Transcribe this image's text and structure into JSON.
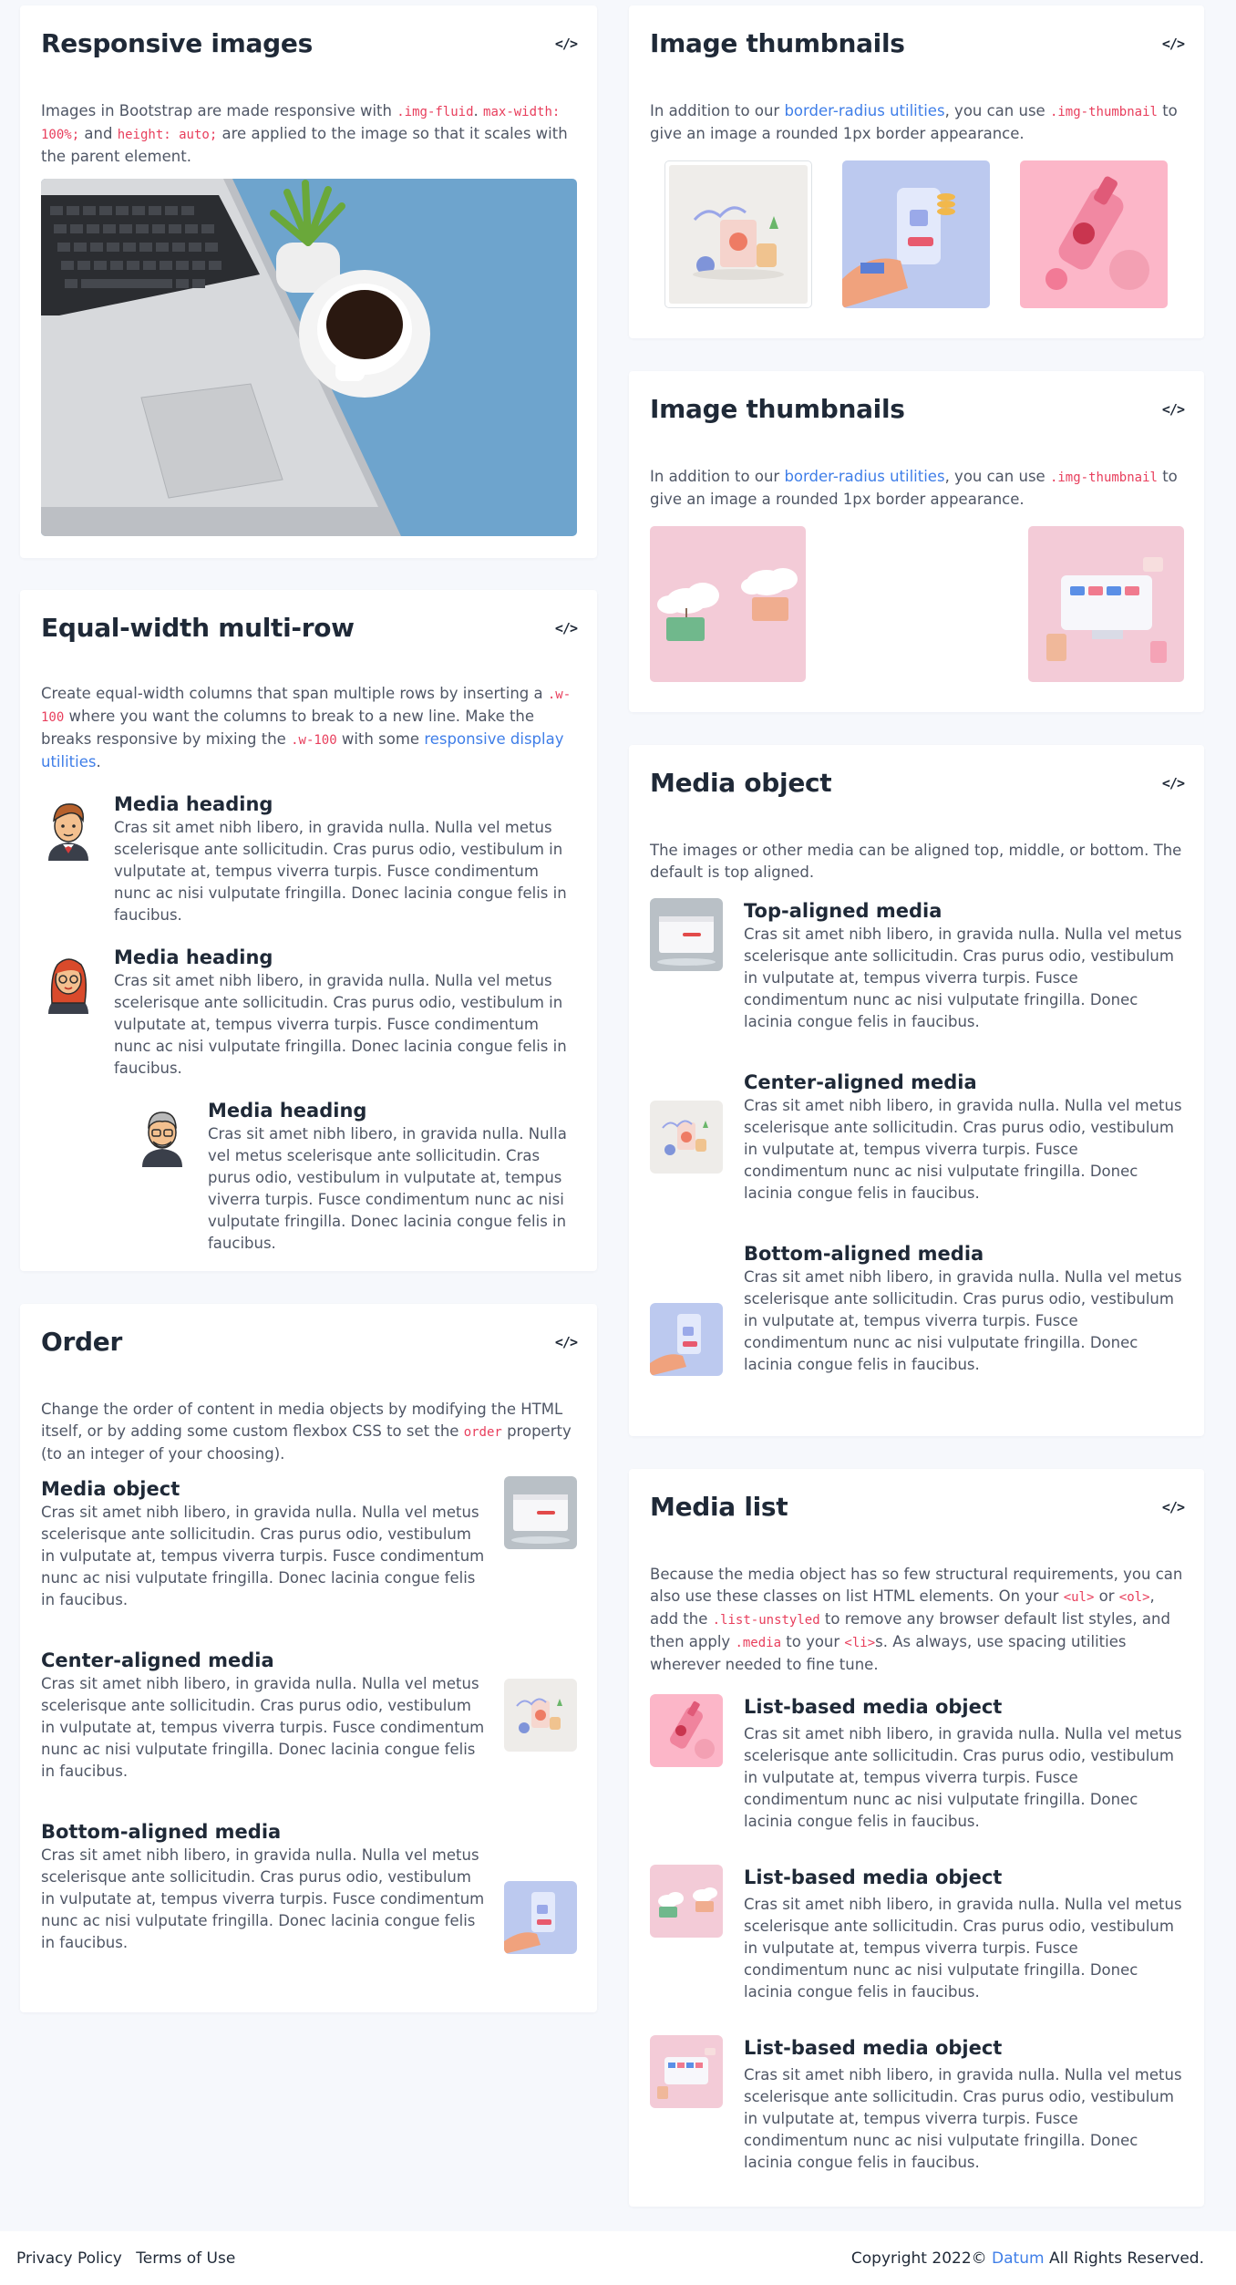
{
  "responsive": {
    "title": "Responsive images",
    "desc_a": "Images in Bootstrap are made responsive with ",
    "code_a": ".img-fluid",
    "desc_b": ". ",
    "code_b": "max-width: 100%;",
    "desc_c": " and ",
    "code_c": "height: auto;",
    "desc_d": " are applied to the image so that it scales with the parent element."
  },
  "thumbs1": {
    "title": "Image thumbnails",
    "desc_a": "In addition to our ",
    "link": "border-radius utilities",
    "desc_b": ", you can use ",
    "code": ".img-thumbnail",
    "desc_c": " to give an image a rounded 1px border appearance."
  },
  "thumbs2": {
    "title": "Image thumbnails",
    "desc_a": "In addition to our ",
    "link": "border-radius utilities",
    "desc_b": ", you can use ",
    "code": ".img-thumbnail",
    "desc_c": " to give an image a rounded 1px border appearance."
  },
  "equal": {
    "title": "Equal-width multi-row",
    "desc_a": "Create equal-width columns that span multiple rows by inserting a ",
    "code_a": ".w-100",
    "desc_b": " where you want the columns to break to a new line. Make the breaks responsive by mixing the ",
    "code_b": ".w-100",
    "desc_c": " with some ",
    "link": "responsive display utilities",
    "desc_d": ".",
    "items": [
      {
        "heading": "Media heading",
        "text": "Cras sit amet nibh libero, in gravida nulla. Nulla vel metus scelerisque ante sollicitudin. Cras purus odio, vestibulum in vulputate at, tempus viverra turpis. Fusce condimentum nunc ac nisi vulputate fringilla. Donec lacinia congue felis in faucibus."
      },
      {
        "heading": "Media heading",
        "text": "Cras sit amet nibh libero, in gravida nulla. Nulla vel metus scelerisque ante sollicitudin. Cras purus odio, vestibulum in vulputate at, tempus viverra turpis. Fusce condimentum nunc ac nisi vulputate fringilla. Donec lacinia congue felis in faucibus."
      },
      {
        "heading": "Media heading",
        "text": "Cras sit amet nibh libero, in gravida nulla. Nulla vel metus scelerisque ante sollicitudin. Cras purus odio, vestibulum in vulputate at, tempus viverra turpis. Fusce condimentum nunc ac nisi vulputate fringilla. Donec lacinia congue felis in faucibus."
      }
    ]
  },
  "mediaobj": {
    "title": "Media object",
    "desc": "The images or other media can be aligned top, middle, or bottom. The default is top aligned.",
    "items": [
      {
        "heading": "Top-aligned media",
        "text": "Cras sit amet nibh libero, in gravida nulla. Nulla vel metus scelerisque ante sollicitudin. Cras purus odio, vestibulum in vulputate at, tempus viverra turpis. Fusce condimentum nunc ac nisi vulputate fringilla. Donec lacinia congue felis in faucibus."
      },
      {
        "heading": "Center-aligned media",
        "text": "Cras sit amet nibh libero, in gravida nulla. Nulla vel metus scelerisque ante sollicitudin. Cras purus odio, vestibulum in vulputate at, tempus viverra turpis. Fusce condimentum nunc ac nisi vulputate fringilla. Donec lacinia congue felis in faucibus."
      },
      {
        "heading": "Bottom-aligned media",
        "text": "Cras sit amet nibh libero, in gravida nulla. Nulla vel metus scelerisque ante sollicitudin. Cras purus odio, vestibulum in vulputate at, tempus viverra turpis. Fusce condimentum nunc ac nisi vulputate fringilla. Donec lacinia congue felis in faucibus."
      }
    ]
  },
  "order": {
    "title": "Order",
    "desc_a": "Change the order of content in media objects by modifying the HTML itself, or by adding some custom flexbox CSS to set the ",
    "code": "order",
    "desc_b": " property (to an integer of your choosing).",
    "items": [
      {
        "heading": "Media object",
        "text": "Cras sit amet nibh libero, in gravida nulla. Nulla vel metus scelerisque ante sollicitudin. Cras purus odio, vestibulum in vulputate at, tempus viverra turpis. Fusce condimentum nunc ac nisi vulputate fringilla. Donec lacinia congue felis in faucibus."
      },
      {
        "heading": "Center-aligned media",
        "text": "Cras sit amet nibh libero, in gravida nulla. Nulla vel metus scelerisque ante sollicitudin. Cras purus odio, vestibulum in vulputate at, tempus viverra turpis. Fusce condimentum nunc ac nisi vulputate fringilla. Donec lacinia congue felis in faucibus."
      },
      {
        "heading": "Bottom-aligned media",
        "text": "Cras sit amet nibh libero, in gravida nulla. Nulla vel metus scelerisque ante sollicitudin. Cras purus odio, vestibulum in vulputate at, tempus viverra turpis. Fusce condimentum nunc ac nisi vulputate fringilla. Donec lacinia congue felis in faucibus."
      }
    ]
  },
  "medialist": {
    "title": "Media list",
    "desc_a": "Because the media object has so few structural requirements, you can also use these classes on list HTML elements. On your ",
    "code_a": "<ul>",
    "desc_b": " or ",
    "code_b": "<ol>",
    "desc_c": ", add the ",
    "code_c": ".list-unstyled",
    "desc_d": " to remove any browser default list styles, and then apply ",
    "code_d": ".media",
    "desc_e": " to your ",
    "code_e": "<li>",
    "desc_f": "s. As always, use spacing utilities wherever needed to fine tune.",
    "items": [
      {
        "heading": "List-based media object",
        "text": "Cras sit amet nibh libero, in gravida nulla. Nulla vel metus scelerisque ante sollicitudin. Cras purus odio, vestibulum in vulputate at, tempus viverra turpis. Fusce condimentum nunc ac nisi vulputate fringilla. Donec lacinia congue felis in faucibus."
      },
      {
        "heading": "List-based media object",
        "text": "Cras sit amet nibh libero, in gravida nulla. Nulla vel metus scelerisque ante sollicitudin. Cras purus odio, vestibulum in vulputate at, tempus viverra turpis. Fusce condimentum nunc ac nisi vulputate fringilla. Donec lacinia congue felis in faucibus."
      },
      {
        "heading": "List-based media object",
        "text": "Cras sit amet nibh libero, in gravida nulla. Nulla vel metus scelerisque ante sollicitudin. Cras purus odio, vestibulum in vulputate at, tempus viverra turpis. Fusce condimentum nunc ac nisi vulputate fringilla. Donec lacinia congue felis in faucibus."
      }
    ]
  },
  "code_toggle": "</>",
  "footer": {
    "privacy": "Privacy Policy",
    "terms": "Terms of Use",
    "copy_a": "Copyright 2022© ",
    "brand": "Datum",
    "copy_b": " All Rights Reserved."
  },
  "colors": {
    "link": "#3f7ee8",
    "code": "#e83e5c",
    "heading": "#1f2937",
    "background": "#f6f8fc"
  }
}
